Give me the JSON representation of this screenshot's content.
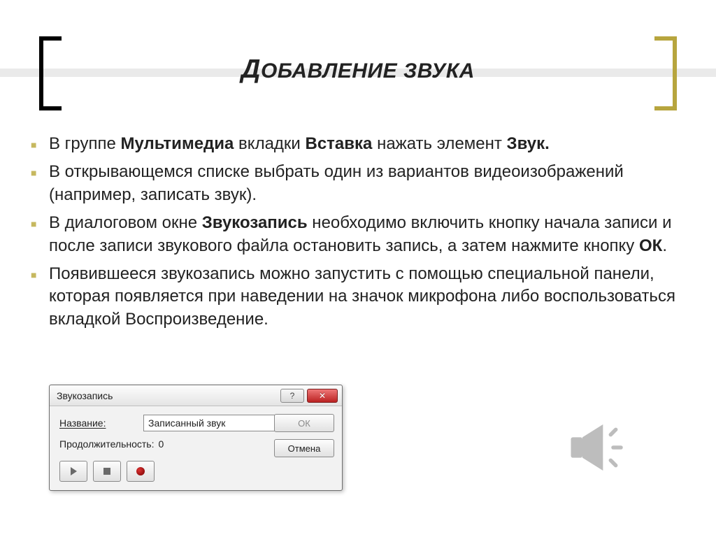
{
  "title_first_char": "Д",
  "title_rest": "ОБАВЛЕНИЕ ЗВУКА",
  "bullets": {
    "b1_pre": "В группе ",
    "b1_bold1": "Мультимедиа",
    "b1_mid1": " вкладки ",
    "b1_bold2": "Вставка",
    "b1_mid2": " нажать элемент ",
    "b1_bold3": "Звук.",
    "b2": "В открывающемся списке выбрать один из вариантов видеоизображений (например, записать звук).",
    "b3_pre": "В диалоговом окне ",
    "b3_bold1": "Звукозапись",
    "b3_mid1": " необходимо включить кнопку начала записи и после записи звукового файла остановить запись, а затем нажмите кнопку ",
    "b3_bold2": "ОК",
    "b3_post": ".",
    "b4": "Появившееся звукозапись можно запустить с помощью специальной панели, которая появляется при наведении на значок микрофона либо воспользоваться вкладкой Воспроизведение."
  },
  "dialog": {
    "caption": "Звукозапись",
    "name_label": "Название:",
    "name_value": "Записанный звук",
    "duration_label": "Продолжительность:",
    "duration_value": "0",
    "ok": "ОК",
    "cancel": "Отмена",
    "help_symbol": "?",
    "close_symbol": "✕"
  }
}
